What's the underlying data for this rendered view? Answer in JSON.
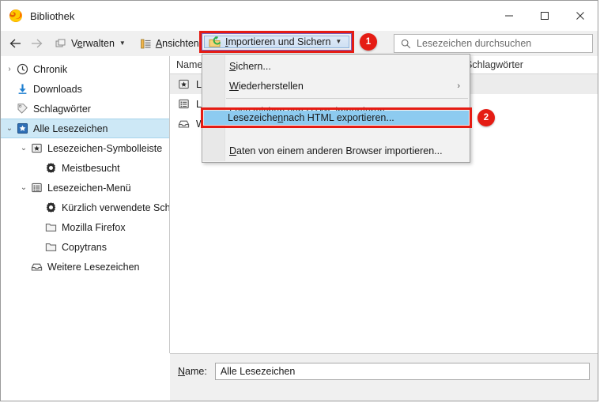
{
  "window": {
    "title": "Bibliothek",
    "app_icon": "firefox-icon",
    "controls": {
      "minimize": "−",
      "maximize": "☐",
      "close": "✕"
    }
  },
  "toolbar": {
    "back": "←",
    "forward": "→",
    "buttons": [
      {
        "name": "organize",
        "label_pre": "V",
        "label_accel": "e",
        "label_post": "rwalten",
        "icon": "organize-icon",
        "caret": "▾"
      },
      {
        "name": "views",
        "label_pre": "",
        "label_accel": "A",
        "label_post": "nsichten",
        "icon": "views-icon",
        "caret": "▾"
      }
    ],
    "import_backup": {
      "label_pre": "",
      "label_accel": "I",
      "label_post": "mportieren und Sichern",
      "icon": "import-backup-icon",
      "caret": "▾"
    }
  },
  "search": {
    "placeholder": "Lesezeichen durchsuchen",
    "icon": "search-icon"
  },
  "sidebar": {
    "items": [
      {
        "label": "Chronik",
        "icon": "clock-icon",
        "twisty": "›",
        "indent": 0,
        "selected": false
      },
      {
        "label": "Downloads",
        "icon": "download-icon",
        "twisty": "",
        "indent": 0,
        "selected": false
      },
      {
        "label": "Schlagwörter",
        "icon": "tag-icon",
        "twisty": "",
        "indent": 0,
        "selected": false
      },
      {
        "label": "Alle Lesezeichen",
        "icon": "all-bookmarks-icon",
        "twisty": "⌄",
        "indent": 0,
        "selected": true
      },
      {
        "label": "Lesezeichen-Symbolleiste",
        "icon": "star-folder-icon",
        "twisty": "⌄",
        "indent": 1,
        "selected": false
      },
      {
        "label": "Meistbesucht",
        "icon": "gear-icon",
        "twisty": "",
        "indent": 2,
        "selected": false
      },
      {
        "label": "Lesezeichen-Menü",
        "icon": "list-folder-icon",
        "twisty": "⌄",
        "indent": 1,
        "selected": false
      },
      {
        "label": "Kürzlich verwendete Schl...",
        "icon": "gear-icon",
        "twisty": "",
        "indent": 2,
        "selected": false
      },
      {
        "label": "Mozilla Firefox",
        "icon": "folder-icon",
        "twisty": "",
        "indent": 2,
        "selected": false
      },
      {
        "label": "Copytrans",
        "icon": "folder-icon",
        "twisty": "",
        "indent": 2,
        "selected": false
      },
      {
        "label": "Weitere Lesezeichen",
        "icon": "unfiled-icon",
        "twisty": "",
        "indent": 1,
        "selected": false
      }
    ]
  },
  "list": {
    "columns": [
      {
        "key": "name",
        "label": "Name"
      },
      {
        "key": "tags",
        "label": "Schlagwörter"
      }
    ],
    "rows": [
      {
        "name": "Lesezeichen-Symbolleiste",
        "icon": "star-folder-icon",
        "selected": true
      },
      {
        "name": "Lesezeichen-Menü",
        "icon": "list-folder-icon",
        "selected": false
      },
      {
        "name": "Weitere Lesezeichen",
        "icon": "unfiled-icon",
        "selected": false
      }
    ]
  },
  "menu": {
    "items": [
      {
        "name": "backup",
        "label_pre": "",
        "label_accel": "S",
        "label_post": "ichern...",
        "submenu": false,
        "separator_after": false
      },
      {
        "name": "restore",
        "label_pre": "",
        "label_accel": "W",
        "label_post": "iederherstellen",
        "submenu": true,
        "submenu_arrow": "›",
        "separator_after": true
      },
      {
        "name": "import-html",
        "label_pre": "Lesezeichen von HTML importieren",
        "label_accel": "",
        "label_post": "",
        "submenu": false,
        "separator_after": false
      },
      {
        "name": "export-html",
        "label_pre": "Lesezeiche",
        "label_accel": "n",
        "label_post": " nach HTML exportieren...",
        "submenu": false,
        "separator_after": false,
        "highlighted": true
      },
      {
        "name": "import-other-browser",
        "label_pre": "",
        "label_accel": "D",
        "label_post": "aten von einem anderen Browser importieren...",
        "submenu": false,
        "separator_after": false
      }
    ]
  },
  "bottom": {
    "name_label_accel": "N",
    "name_label_post": "ame:",
    "name_value": "Alle Lesezeichen"
  },
  "annotations": {
    "badges": [
      {
        "name": "step-badge-1",
        "text": "1"
      },
      {
        "name": "step-badge-2",
        "text": "2"
      }
    ],
    "highlight_color": "#e51c14"
  }
}
